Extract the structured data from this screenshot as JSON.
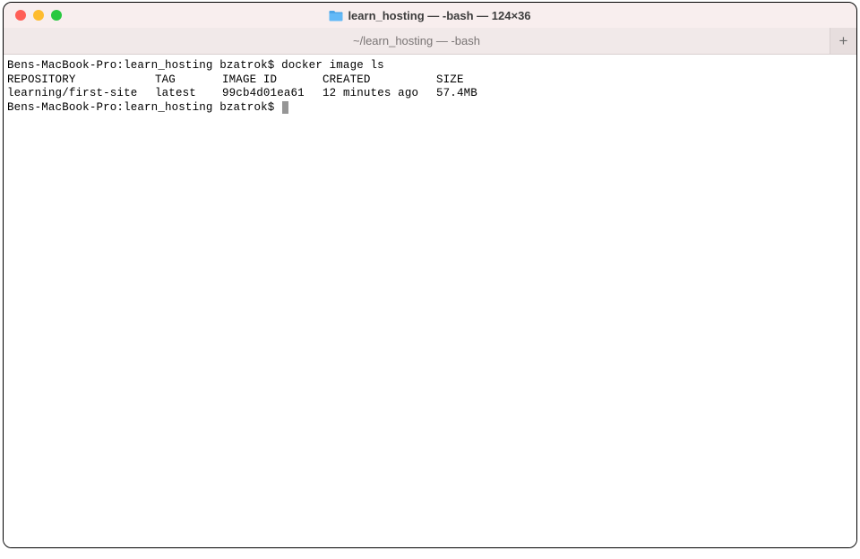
{
  "window": {
    "title": "learn_hosting — -bash — 124×36"
  },
  "tab": {
    "label": "~/learn_hosting — -bash"
  },
  "terminal": {
    "line1_prompt": "Bens-MacBook-Pro:learn_hosting bzatrok$ ",
    "line1_cmd": "docker image ls",
    "headers": {
      "repository": "REPOSITORY",
      "tag": "TAG",
      "image_id": "IMAGE ID",
      "created": "CREATED",
      "size": "SIZE"
    },
    "row1": {
      "repository": "learning/first-site",
      "tag": "latest",
      "image_id": "99cb4d01ea61",
      "created": "12 minutes ago",
      "size": "57.4MB"
    },
    "line4_prompt": "Bens-MacBook-Pro:learn_hosting bzatrok$ "
  },
  "chart_data": {
    "type": "table",
    "title": "docker image ls",
    "columns": [
      "REPOSITORY",
      "TAG",
      "IMAGE ID",
      "CREATED",
      "SIZE"
    ],
    "rows": [
      [
        "learning/first-site",
        "latest",
        "99cb4d01ea61",
        "12 minutes ago",
        "57.4MB"
      ]
    ]
  }
}
